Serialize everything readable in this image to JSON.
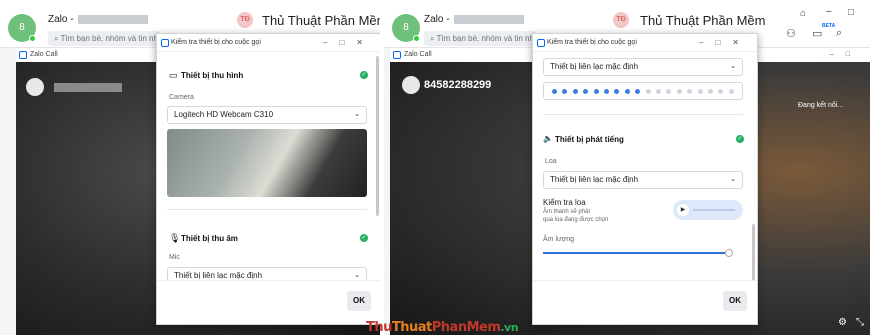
{
  "app": {
    "me_avatar_letter": "8",
    "title": "Zalo -",
    "search_placeholder": "Tìm bạn bè, nhóm và tin nhắn",
    "contact_initials": "TĐ",
    "contact_name": "Thủ Thuật Phần Mềm",
    "beta_label": "BETA"
  },
  "call_window": {
    "title": "Zalo Call",
    "right_peer_number": "84582288299",
    "connecting_text": "Đang kết nối..."
  },
  "dialog": {
    "title": "Kiểm tra thiết bị cho cuộc gọi",
    "camera_section_title": "Thiết bị thu hình",
    "camera_label": "Camera",
    "camera_value": "Logitech HD Webcam C310",
    "mic_section_title": "Thiết bị thu âm",
    "mic_label": "Mic",
    "mic_value": "Thiết bị liên lạc mặc định",
    "speaker_section_title": "Thiết bị phát tiếng",
    "speaker_label": "Loa",
    "speaker_value": "Thiết bị liên lạc mặc định",
    "speaker_test_title": "Kiểm tra loa",
    "speaker_test_desc_1": "Âm thanh sẽ phát",
    "speaker_test_desc_2": "qua loa đang được chọn",
    "volume_label": "Âm lượng",
    "ok_label": "OK",
    "mic_level_active_dots": 9,
    "mic_level_total_dots": 18,
    "volume_level": 0.97
  },
  "watermark": {
    "part1": "Thu",
    "part2": "Thuat",
    "part3": "PhanMem",
    "part4": ".vn"
  },
  "colors": {
    "accent": "#0068ff",
    "check": "#27ae60",
    "level_active": "#3b7de0",
    "level_inactive": "#cfd4dc"
  }
}
